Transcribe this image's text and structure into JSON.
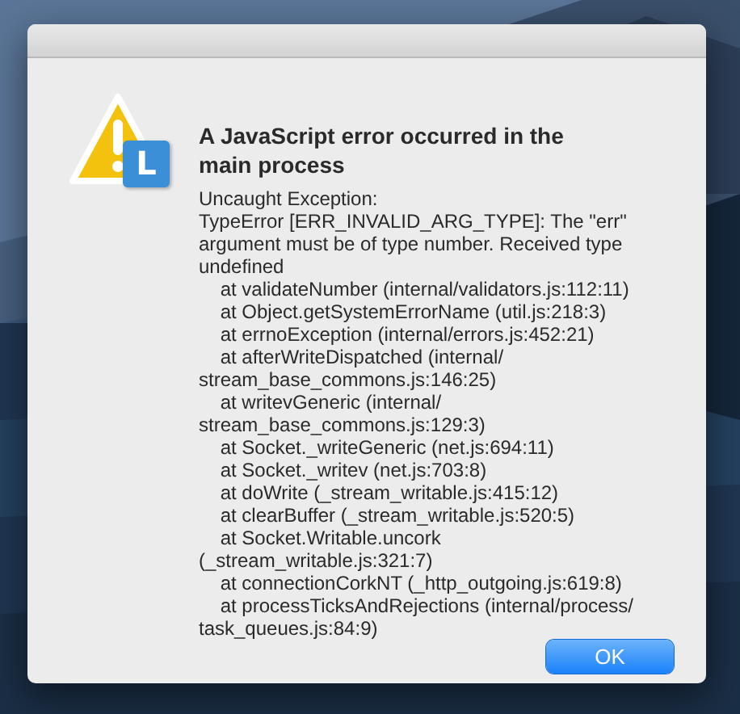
{
  "dialog": {
    "title": "A JavaScript error occurred in the main process",
    "app_badge": "L",
    "message": "Uncaught Exception:\nTypeError [ERR_INVALID_ARG_TYPE]: The \"err\"\nargument must be of type number. Received type\nundefined\n    at validateNumber (internal/validators.js:112:11)\n    at Object.getSystemErrorName (util.js:218:3)\n    at errnoException (internal/errors.js:452:21)\n    at afterWriteDispatched (internal/\nstream_base_commons.js:146:25)\n    at writevGeneric (internal/\nstream_base_commons.js:129:3)\n    at Socket._writeGeneric (net.js:694:11)\n    at Socket._writev (net.js:703:8)\n    at doWrite (_stream_writable.js:415:12)\n    at clearBuffer (_stream_writable.js:520:5)\n    at Socket.Writable.uncork\n(_stream_writable.js:321:7)\n    at connectionCorkNT (_http_outgoing.js:619:8)\n    at processTicksAndRejections (internal/process/\ntask_queues.js:84:9)",
    "buttons": [
      {
        "label": "OK",
        "default": true
      }
    ]
  }
}
